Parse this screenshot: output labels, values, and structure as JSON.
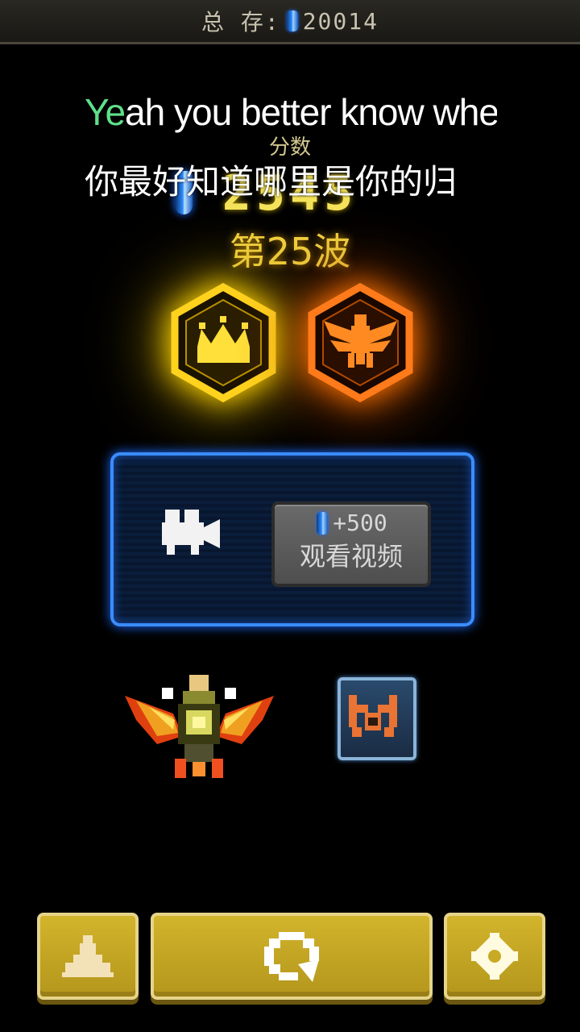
{
  "top_bar": {
    "label": "总 存:",
    "gems_total": "20014",
    "gem_icon": "blue-gem-icon"
  },
  "lyrics": {
    "english_highlight": "Ye",
    "english_rest": "ah you better know whe",
    "chinese": "你最好知道哪里是你的归"
  },
  "score": {
    "title": "分数",
    "value": "2545"
  },
  "wave": {
    "label": "第25波"
  },
  "medals": [
    {
      "name": "crown-medal",
      "color": "#ffd21e"
    },
    {
      "name": "eagle-medal",
      "color": "#ff7a1a"
    }
  ],
  "video_offer": {
    "reward": "+500",
    "button_label": "观看视频",
    "icon": "video-camera-icon"
  },
  "bottom_buttons": {
    "left_icon": "spaceship-icon",
    "center_icon": "replay-icon",
    "right_icon": "gear-icon"
  },
  "colors": {
    "gold": "#f4e35a",
    "panel_border": "#3a8cff",
    "button_yellow": "#c8aa24"
  }
}
